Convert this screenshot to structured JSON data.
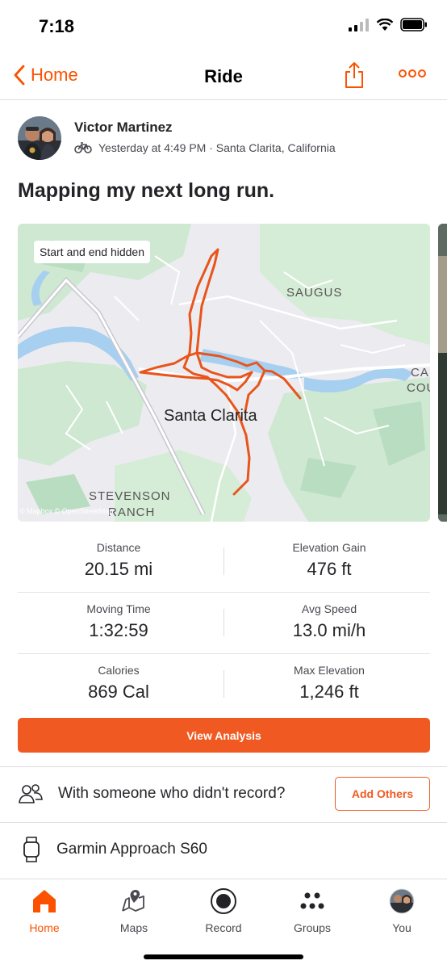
{
  "status_bar": {
    "time": "7:18"
  },
  "nav": {
    "back_label": "Home",
    "title": "Ride"
  },
  "athlete": {
    "name": "Victor Martinez",
    "meta": "Yesterday at 4:49 PM · Santa Clarita, California"
  },
  "activity": {
    "title": "Mapping my next long run."
  },
  "map": {
    "badge": "Start and end hidden",
    "labels": {
      "saugus": "SAUGUS",
      "city": "Santa Clarita",
      "stevenson_1": "STEVENSON",
      "stevenson_2": "RANCH",
      "canyon_1": "CA",
      "canyon_2": "COU"
    },
    "attribution": "© Mapbox © OpenStreetMap",
    "route_color": "#e8551c"
  },
  "stats": [
    {
      "left": {
        "label": "Distance",
        "value": "20.15 mi"
      },
      "right": {
        "label": "Elevation Gain",
        "value": "476 ft"
      }
    },
    {
      "left": {
        "label": "Moving Time",
        "value": "1:32:59"
      },
      "right": {
        "label": "Avg Speed",
        "value": "13.0 mi/h"
      }
    },
    {
      "left": {
        "label": "Calories",
        "value": "869 Cal"
      },
      "right": {
        "label": "Max Elevation",
        "value": "1,246 ft"
      }
    }
  ],
  "actions": {
    "view_analysis": "View Analysis",
    "add_others": "Add Others"
  },
  "with_others": {
    "text": "With someone who didn't record?"
  },
  "device": {
    "name": "Garmin Approach S60"
  },
  "tabs": [
    {
      "label": "Home"
    },
    {
      "label": "Maps"
    },
    {
      "label": "Record"
    },
    {
      "label": "Groups"
    },
    {
      "label": "You"
    }
  ],
  "colors": {
    "brand": "#fc5200",
    "button": "#f05a22"
  }
}
